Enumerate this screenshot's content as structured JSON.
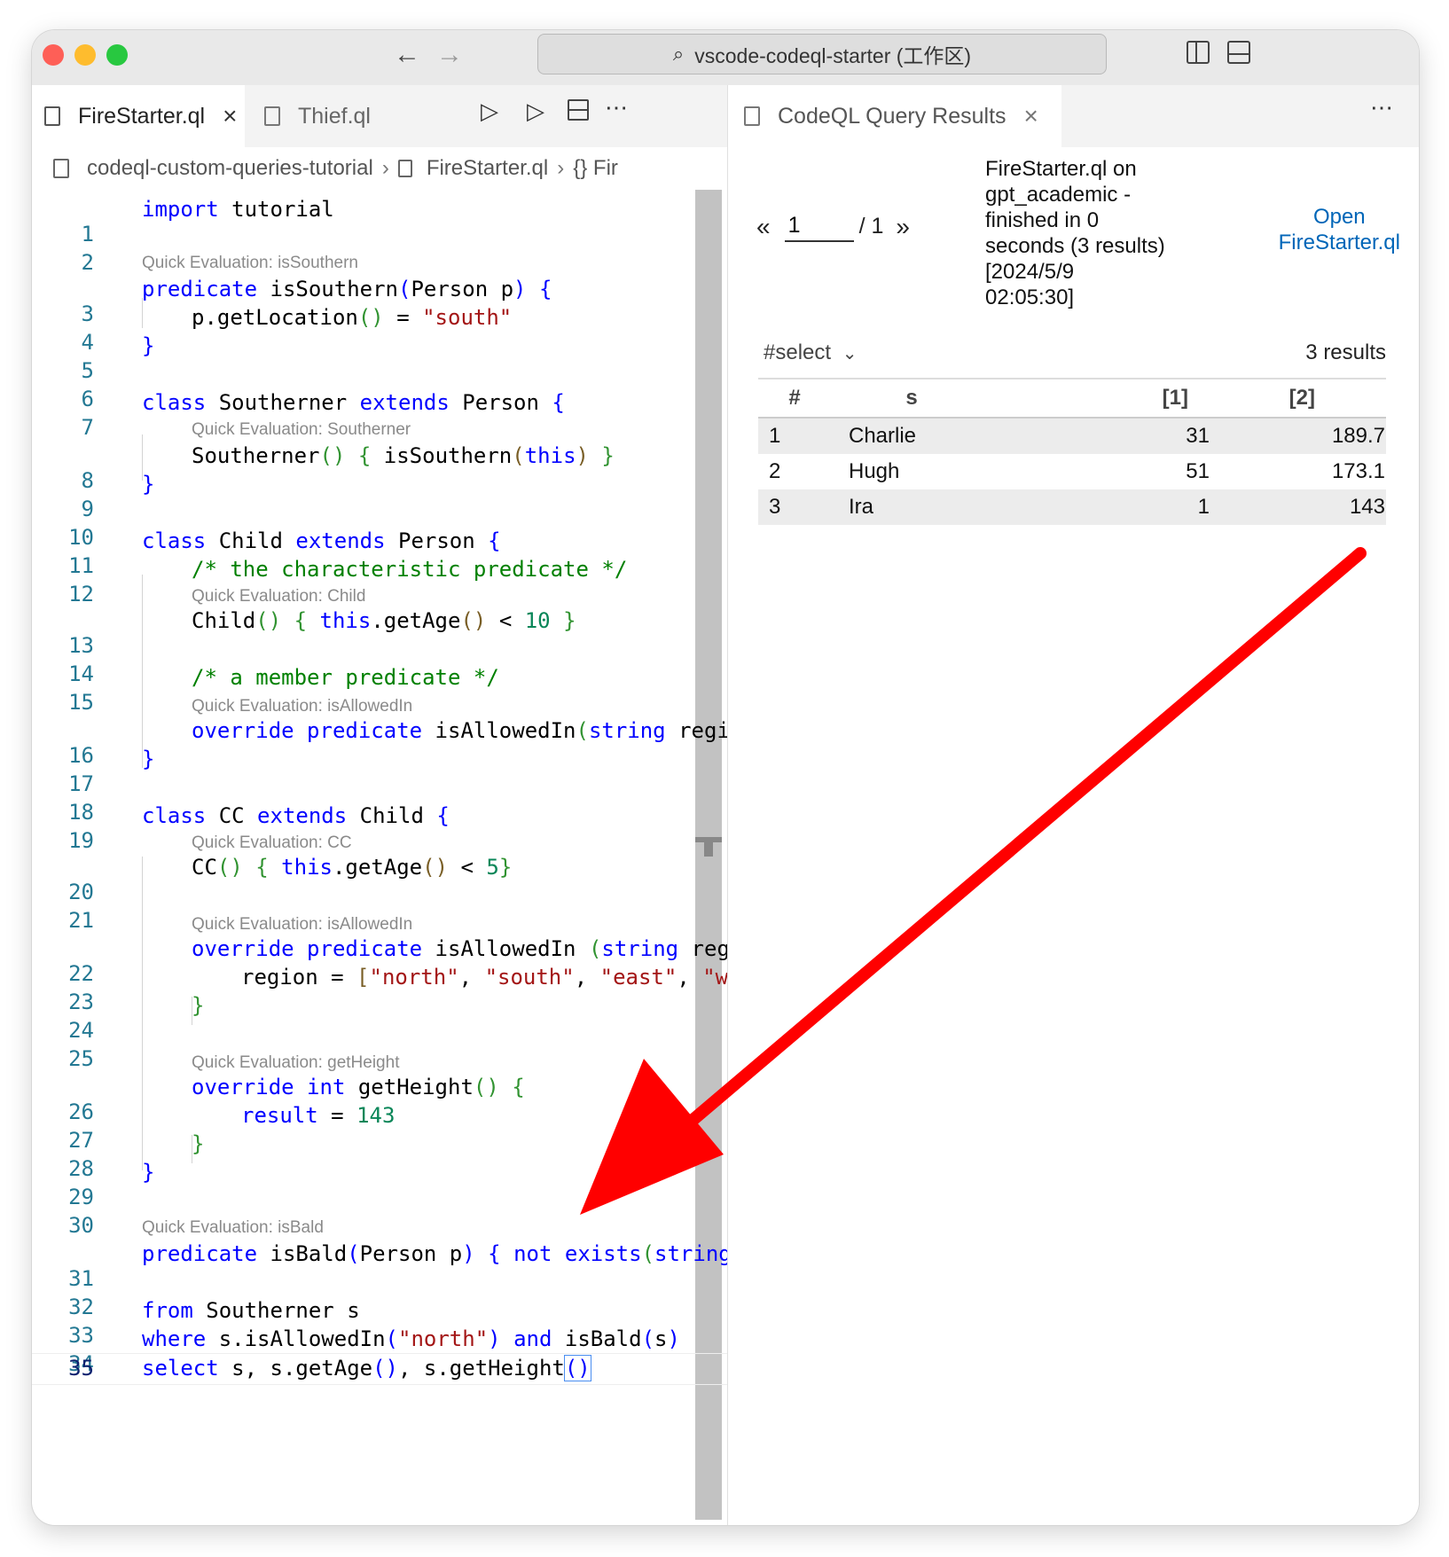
{
  "window": {
    "title": "vscode-codeql-starter (工作区)"
  },
  "editor_tabs": [
    {
      "label": "FireStarter.ql",
      "active": true
    },
    {
      "label": "Thief.ql",
      "active": false
    }
  ],
  "breadcrumb": {
    "folder": "codeql-custom-queries-tutorial",
    "file": "FireStarter.ql",
    "symbol": "{} Fir"
  },
  "code_lenses": {
    "isSouthern": "Quick Evaluation: isSouthern",
    "Southerner": "Quick Evaluation: Southerner",
    "Child": "Quick Evaluation: Child",
    "isAllowedIn1": "Quick Evaluation: isAllowedIn",
    "CC": "Quick Evaluation: CC",
    "isAllowedIn2": "Quick Evaluation: isAllowedIn",
    "getHeight": "Quick Evaluation: getHeight",
    "isBald": "Quick Evaluation: isBald"
  },
  "line_numbers": [
    "1",
    "2",
    "3",
    "4",
    "5",
    "6",
    "7",
    "8",
    "9",
    "10",
    "11",
    "12",
    "13",
    "14",
    "15",
    "16",
    "17",
    "18",
    "19",
    "20",
    "21",
    "22",
    "23",
    "24",
    "25",
    "26",
    "27",
    "28",
    "29",
    "30",
    "31",
    "32",
    "33",
    "34",
    "35"
  ],
  "code": {
    "l1": [
      "import",
      " tutorial"
    ],
    "l3": [
      "predicate",
      " isSouthern",
      "(",
      "Person p",
      ")",
      " {"
    ],
    "l4": [
      "p.getLocation",
      "()",
      " = ",
      "\"south\""
    ],
    "l5": [
      "}"
    ],
    "l7": [
      "class",
      " Southerner ",
      "extends",
      " Person ",
      "{"
    ],
    "l8": [
      "Southerner",
      "()",
      " { ",
      "isSouthern",
      "(",
      "this",
      ")",
      " }"
    ],
    "l9": [
      "}"
    ],
    "l11": [
      "class",
      " Child ",
      "extends",
      " Person ",
      "{"
    ],
    "l12": [
      "/* the characteristic predicate */"
    ],
    "l13": [
      "Child",
      "()",
      " { ",
      "this",
      ".getAge",
      "()",
      " < ",
      "10",
      " }"
    ],
    "l15": [
      "/* a member predicate */"
    ],
    "l16": [
      "override",
      " ",
      "predicate",
      " isAllowedIn",
      "(",
      "string",
      " regi"
    ],
    "l17": [
      "}"
    ],
    "l19": [
      "class",
      " CC ",
      "extends",
      " Child ",
      "{"
    ],
    "l20": [
      "CC",
      "()",
      " { ",
      "this",
      ".getAge",
      "()",
      " < ",
      "5",
      "}"
    ],
    "l22": [
      "override",
      " ",
      "predicate",
      " isAllowedIn ",
      "(",
      "string",
      " reg"
    ],
    "l23": [
      "region = ",
      "[",
      "\"north\"",
      ", ",
      "\"south\"",
      ", ",
      "\"east\"",
      ", ",
      "\"w"
    ],
    "l24": [
      "}"
    ],
    "l26": [
      "override",
      " ",
      "int",
      " getHeight",
      "()",
      " {"
    ],
    "l27": [
      "result",
      " = ",
      "143"
    ],
    "l28": [
      "}"
    ],
    "l29": [
      "}"
    ],
    "l31": [
      "predicate",
      " isBald",
      "(",
      "Person p",
      ")",
      " { ",
      "not",
      " ",
      "exists",
      "(",
      "string"
    ],
    "l33": [
      "from",
      " Southerner s"
    ],
    "l34": [
      "where",
      " s.isAllowedIn",
      "(",
      "\"north\"",
      ")",
      " ",
      "and",
      " isBald",
      "(",
      "s",
      ")"
    ],
    "l35": [
      "select",
      " s, s.getAge",
      "()",
      ", s.getHeight",
      "()"
    ]
  },
  "results_panel": {
    "tab_label": "CodeQL Query Results",
    "page_current": "1",
    "page_total": "/ 1",
    "prev": "«",
    "next": "»",
    "info_lines": [
      "FireStarter.ql on",
      "gpt_academic -",
      "finished in 0",
      "seconds (3 results)",
      "[2024/5/9",
      "02:05:30]"
    ],
    "open_link_lines": [
      "Open",
      "FireStarter.ql"
    ],
    "result_set": "#select",
    "result_count": "3 results",
    "columns": [
      "#",
      "s",
      "[1]",
      "[2]"
    ],
    "rows": [
      [
        "1",
        "Charlie",
        "31",
        "189.7"
      ],
      [
        "2",
        "Hugh",
        "51",
        "173.1"
      ],
      [
        "3",
        "Ira",
        "1",
        "143"
      ]
    ]
  },
  "annotation": {
    "arrow_color": "#ff0000"
  },
  "colors": {
    "keyword": "#0000ff",
    "string": "#a31515",
    "comment": "#008000",
    "number": "#098658",
    "link": "#0066b8"
  }
}
